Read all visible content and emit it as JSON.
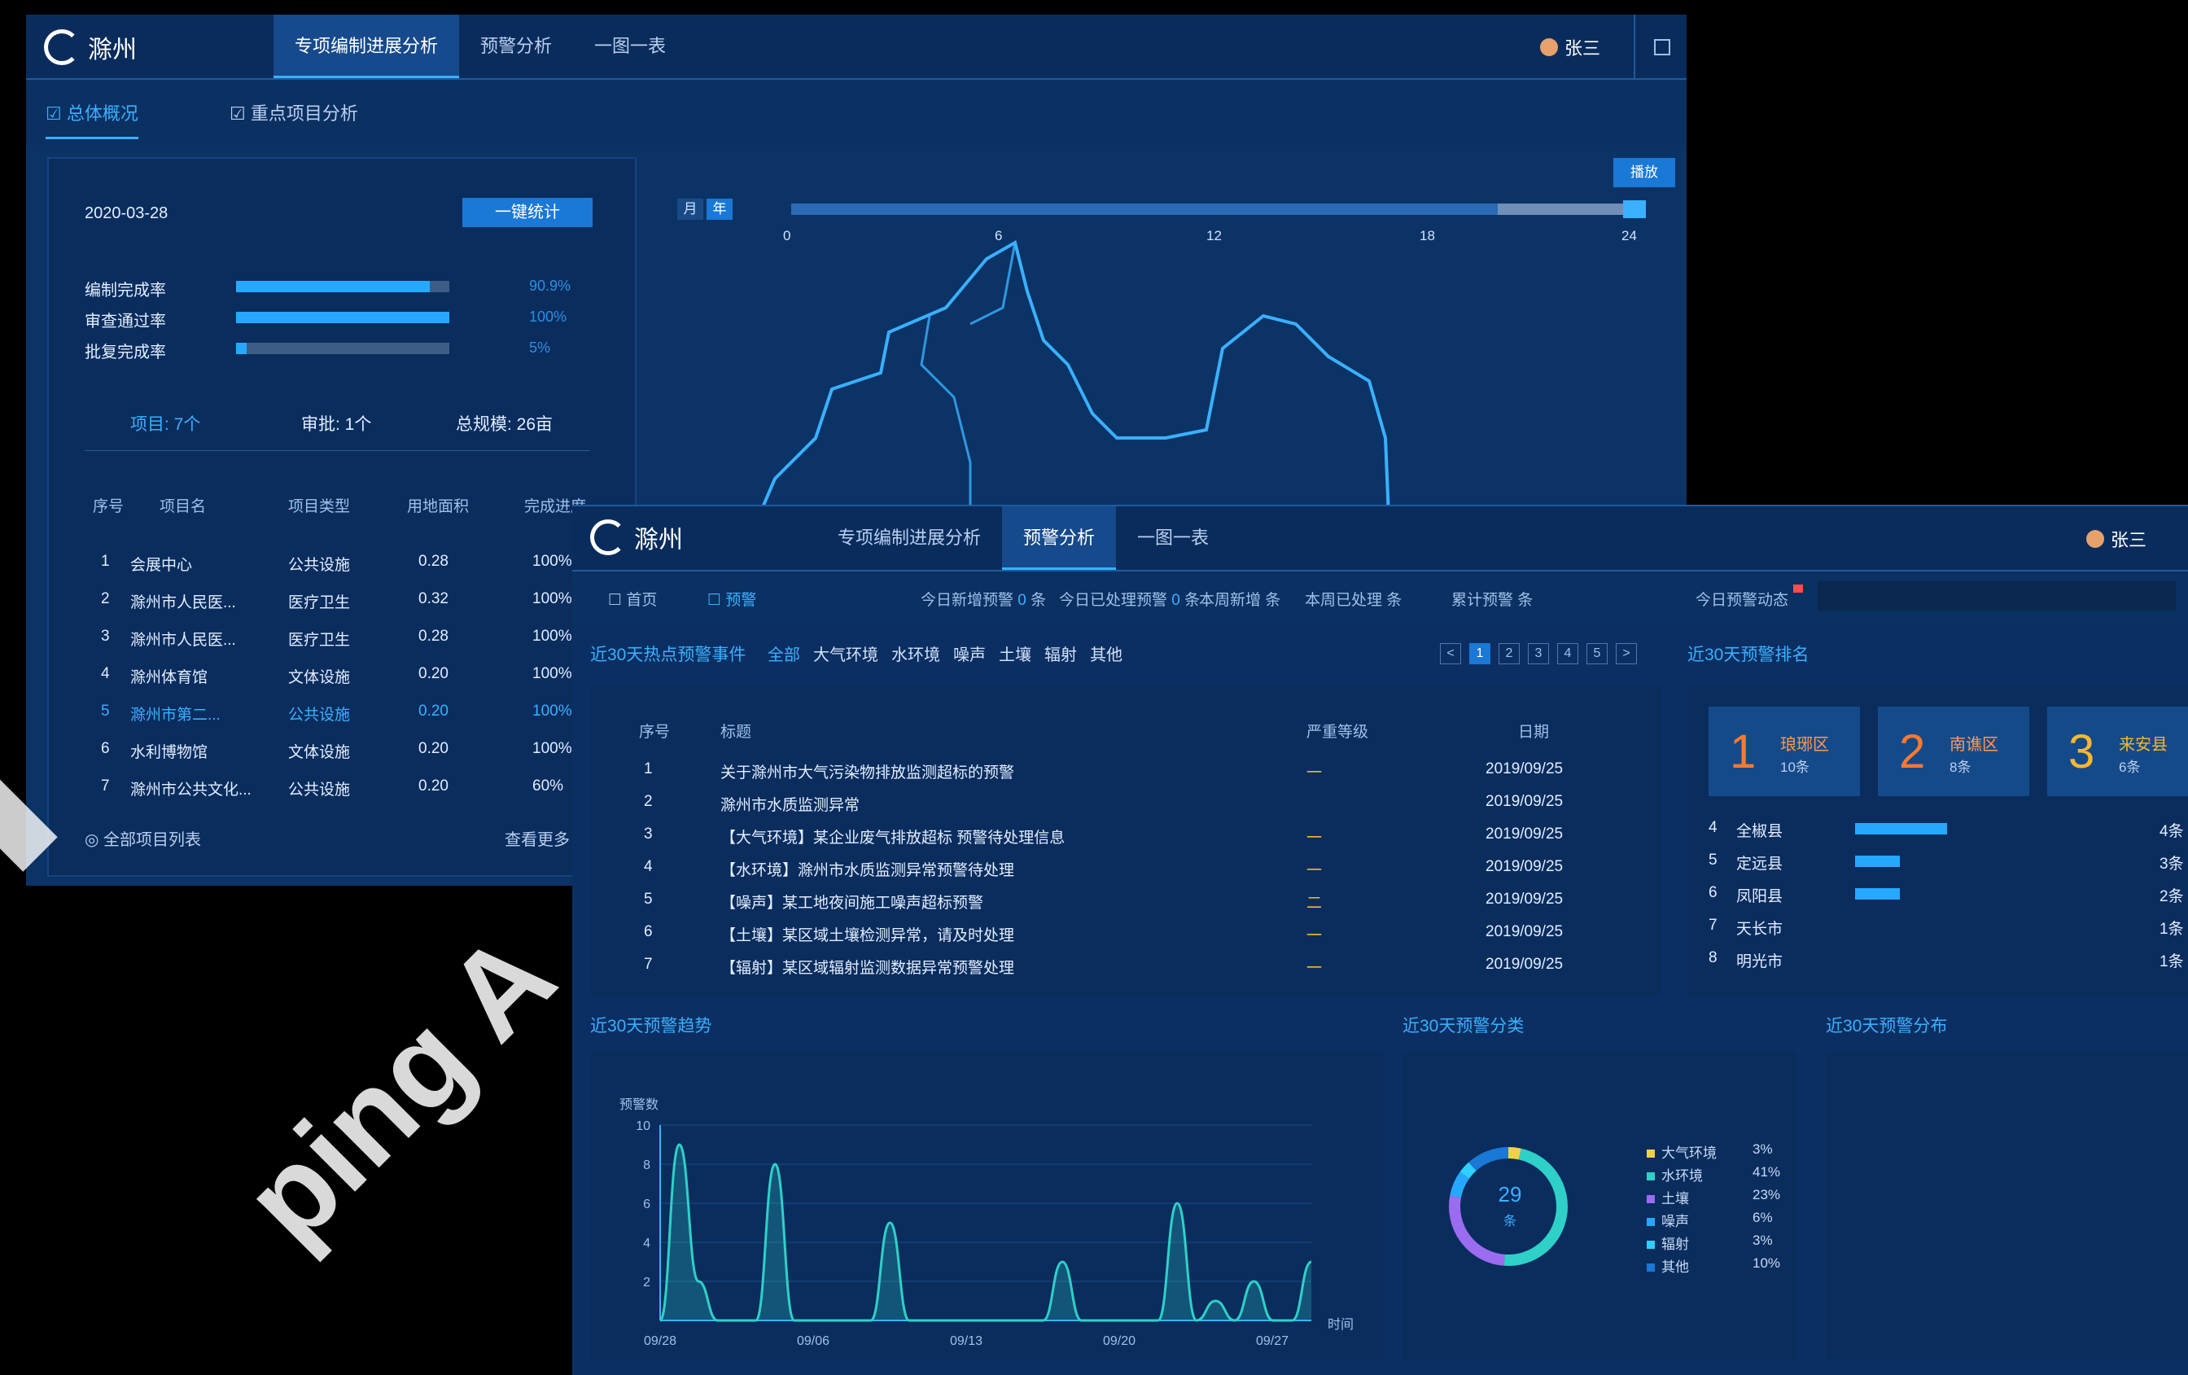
{
  "back_window": {
    "brand": "滁州",
    "nav": [
      "专项编制进展分析",
      "预警分析",
      "一图一表"
    ],
    "user": "张三",
    "subtabs": [
      "总体概况",
      "重点项目分析"
    ],
    "date": "2020-03-28",
    "button": "一键统计",
    "progress": [
      {
        "label": "编制完成率",
        "value": 90.9,
        "pct": "90.9%"
      },
      {
        "label": "审查通过率",
        "value": 100,
        "pct": "100%"
      },
      {
        "label": "批复完成率",
        "value": 5,
        "pct": "5%"
      }
    ],
    "stats": [
      "项目: 7个",
      "审批: 1个",
      "总规模: 26亩"
    ],
    "table_headers": [
      "序号",
      "项目名",
      "项目类型",
      "用地面积",
      "完成进度"
    ],
    "rows": [
      {
        "n": "1",
        "name": "会展中心",
        "type": "公共设施",
        "area": "0.28",
        "prog": "100%"
      },
      {
        "n": "2",
        "name": "滁州市人民医...",
        "type": "医疗卫生",
        "area": "0.32",
        "prog": "100%"
      },
      {
        "n": "3",
        "name": "滁州市人民医...",
        "type": "医疗卫生",
        "area": "0.28",
        "prog": "100%"
      },
      {
        "n": "4",
        "name": "滁州体育馆",
        "type": "文体设施",
        "area": "0.20",
        "prog": "100%"
      },
      {
        "n": "5",
        "name": "滁州市第二...",
        "type": "公共设施",
        "area": "0.20",
        "prog": "100%"
      },
      {
        "n": "6",
        "name": "水利博物馆",
        "type": "文体设施",
        "area": "0.20",
        "prog": "100%"
      },
      {
        "n": "7",
        "name": "滁州市公共文化...",
        "type": "公共设施",
        "area": "0.20",
        "prog": "60%"
      }
    ],
    "footer_left": "全部项目列表",
    "footer_right": "查看更多",
    "slider_labels": [
      "月",
      "年"
    ],
    "slider_ticks": [
      "0",
      "6",
      "12",
      "18",
      "24"
    ],
    "slider_button": "播放"
  },
  "front_window": {
    "brand": "滁州",
    "nav": [
      "专项编制进展分析",
      "预警分析",
      "一图一表"
    ],
    "user": "张三",
    "toolbar_tabs": [
      "首页",
      "预警"
    ],
    "toolbar_stats": [
      {
        "label": "今日新增预警",
        "num": "0",
        "unit": "条"
      },
      {
        "label": "今日已处理预警",
        "num": "0",
        "unit": "条"
      },
      {
        "label": "本周新增",
        "num": "",
        "unit": "条"
      },
      {
        "label": "本周已处理",
        "num": "",
        "unit": "条"
      },
      {
        "label": "累计预警",
        "num": "",
        "unit": "条"
      }
    ],
    "alert_label": "今日预警动态",
    "list_title": "近30天热点预警事件",
    "filters": [
      "全部",
      "大气环境",
      "水环境",
      "噪声",
      "土壤",
      "辐射",
      "其他"
    ],
    "pages": [
      "<",
      "1",
      "2",
      "3",
      "4",
      "5",
      ">"
    ],
    "list_headers": [
      "序号",
      "标题",
      "严重等级",
      "日期"
    ],
    "list_rows": [
      {
        "n": "1",
        "title": "关于滁州市大气污染物排放监测超标的预警",
        "lvl": "一",
        "date": "2019/09/25"
      },
      {
        "n": "2",
        "title": "滁州市水质监测异常",
        "lvl": "",
        "date": "2019/09/25"
      },
      {
        "n": "3",
        "title": "【大气环境】某企业废气排放超标 预警待处理信息",
        "lvl": "一",
        "date": "2019/09/25"
      },
      {
        "n": "4",
        "title": "【水环境】滁州市水质监测异常预警待处理",
        "lvl": "一",
        "date": "2019/09/25"
      },
      {
        "n": "5",
        "title": "【噪声】某工地夜间施工噪声超标预警",
        "lvl": "二",
        "date": "2019/09/25"
      },
      {
        "n": "6",
        "title": "【土壤】某区域土壤检测异常，请及时处理",
        "lvl": "一",
        "date": "2019/09/25"
      },
      {
        "n": "7",
        "title": "【辐射】某区域辐射监测数据异常预警处理",
        "lvl": "一",
        "date": "2019/09/25"
      }
    ],
    "rank_title": "近30天预警排名",
    "top3": [
      {
        "rank": "1",
        "name": "琅琊区",
        "score": "10条"
      },
      {
        "rank": "2",
        "name": "南谯区",
        "score": "8条"
      },
      {
        "rank": "3",
        "name": "来安县",
        "score": "6条"
      }
    ],
    "rank_rows": [
      {
        "n": "4",
        "name": "全椒县",
        "value": 0.45,
        "tail": "4条"
      },
      {
        "n": "5",
        "name": "定远县",
        "value": 0.22,
        "tail": "3条"
      },
      {
        "n": "6",
        "name": "凤阳县",
        "value": 0.22,
        "tail": "2条"
      },
      {
        "n": "7",
        "name": "天长市",
        "value": 0,
        "tail": "1条"
      },
      {
        "n": "8",
        "name": "明光市",
        "value": 0,
        "tail": "1条"
      }
    ],
    "trend_title": "近30天预警趋势",
    "type_title": "近30天预警分类",
    "map_title": "近30天预警分布",
    "donut_total": "29",
    "donut_unit": "条",
    "donut_legend": [
      {
        "name": "大气环境",
        "value": "3%",
        "color": "#f2d04a"
      },
      {
        "name": "水环境",
        "value": "41%",
        "color": "#2fd0c8"
      },
      {
        "name": "土壤",
        "value": "23%",
        "color": "#9b6cf0"
      },
      {
        "name": "噪声",
        "value": "6%",
        "color": "#27a8ff"
      },
      {
        "name": "辐射",
        "value": "3%",
        "color": "#2fd0ff"
      },
      {
        "name": "其他",
        "value": "10%",
        "color": "#1a78d6"
      }
    ]
  },
  "chart_data": {
    "type": "area",
    "ylabel": "预警数",
    "xlabel": "时间",
    "ylim": [
      0,
      10
    ],
    "yticks": [
      "10",
      "8",
      "6",
      "4",
      "2"
    ],
    "xticks": [
      "09/28",
      "09/06",
      "09/13",
      "09/20",
      "09/27"
    ],
    "values": [
      0,
      9,
      2,
      0,
      0,
      0,
      8,
      0,
      0,
      0,
      0,
      0,
      5,
      0,
      0,
      0,
      0,
      0,
      0,
      0,
      0,
      3,
      0,
      0,
      0,
      0,
      0,
      6,
      0,
      1,
      0,
      2,
      0,
      0,
      3
    ]
  },
  "watermark": "ping A"
}
